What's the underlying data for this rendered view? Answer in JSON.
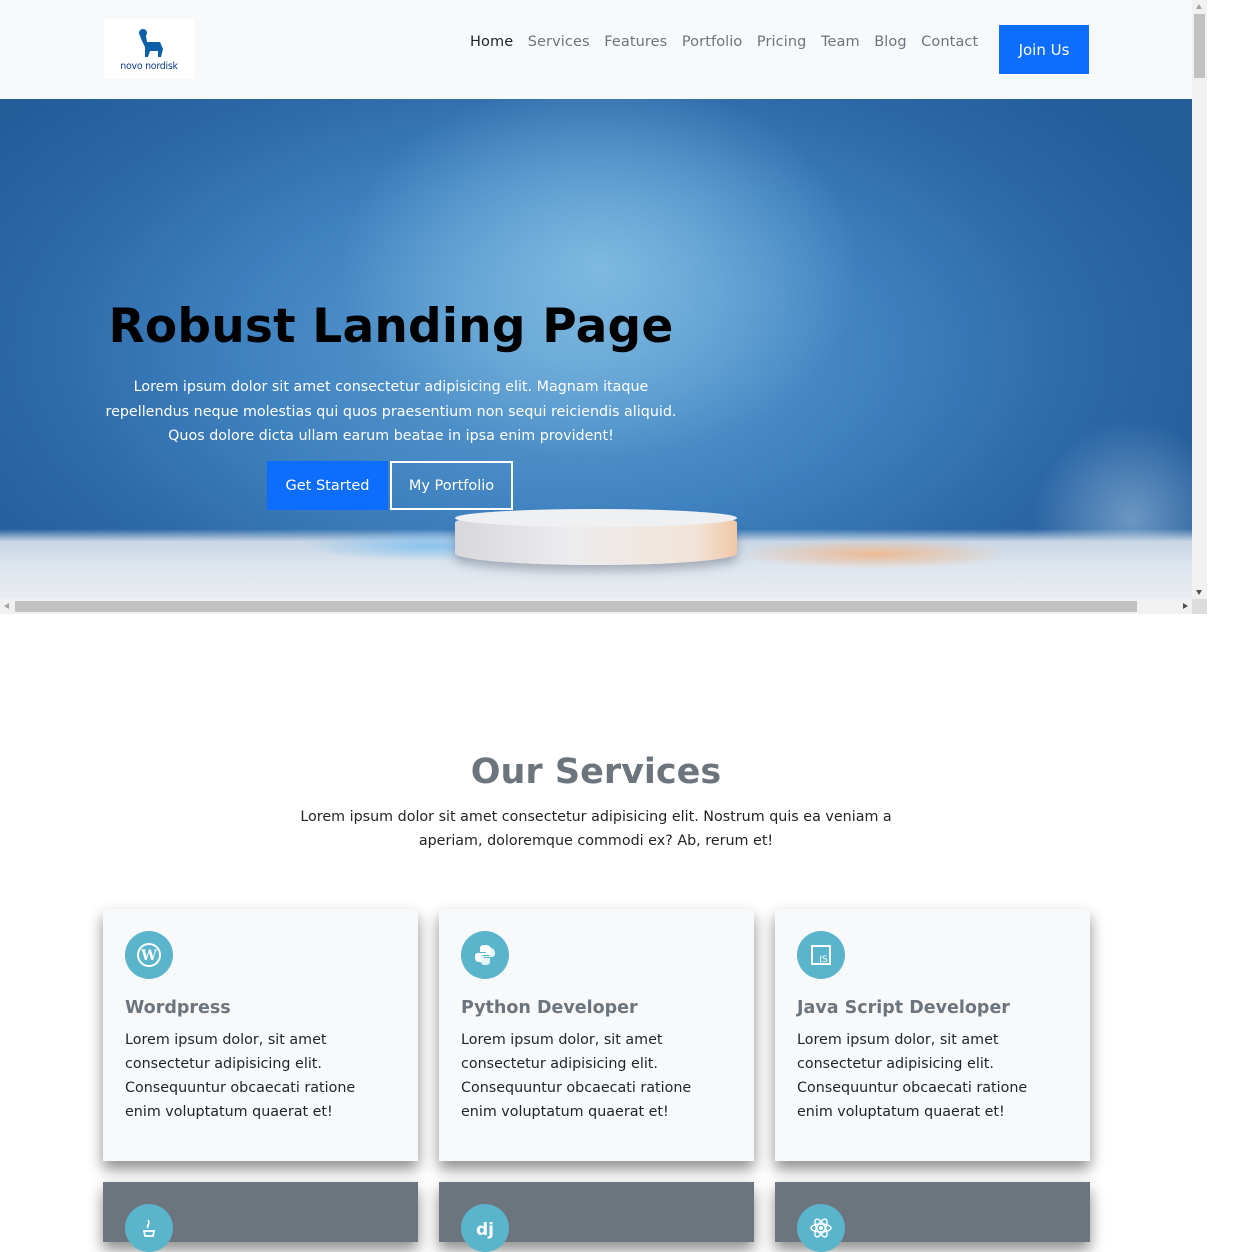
{
  "brand": {
    "logo_text": "novo nordisk",
    "color": "#0d3b8a"
  },
  "nav": {
    "items": [
      "Home",
      "Services",
      "Features",
      "Portfolio",
      "Pricing",
      "Team",
      "Blog",
      "Contact"
    ],
    "active": "Home",
    "join_label": "Join Us"
  },
  "hero": {
    "title": "Robust Landing Page",
    "description": "Lorem ipsum dolor sit amet consectetur adipisicing elit. Magnam itaque repellendus neque molestias qui quos praesentium non sequi reiciendis aliquid. Quos dolore dicta ullam earum beatae in ipsa enim provident!",
    "primary_button": "Get Started",
    "secondary_button": "My Portfolio"
  },
  "services": {
    "title": "Our Services",
    "description": "Lorem ipsum dolor sit amet consectetur adipisicing elit. Nostrum quis ea veniam a aperiam, doloremque commodi ex? Ab, rerum et!",
    "cards": [
      {
        "icon": "wordpress-icon",
        "title": "Wordpress",
        "text": "Lorem ipsum dolor, sit amet consectetur adipisicing elit. Consequuntur obcaecati ratione enim voluptatum quaerat et!"
      },
      {
        "icon": "python-icon",
        "title": "Python Developer",
        "text": "Lorem ipsum dolor, sit amet consectetur adipisicing elit. Consequuntur obcaecati ratione enim voluptatum quaerat et!"
      },
      {
        "icon": "javascript-icon",
        "title": "Java Script Developer",
        "text": "Lorem ipsum dolor, sit amet consectetur adipisicing elit. Consequuntur obcaecati ratione enim voluptatum quaerat et!"
      }
    ],
    "next_row_icons": [
      "java-icon",
      "django-icon",
      "react-icon"
    ]
  },
  "colors": {
    "primary": "#0d6efd",
    "secondary": "#6c757d",
    "icon_bg": "#5ab4cc"
  }
}
